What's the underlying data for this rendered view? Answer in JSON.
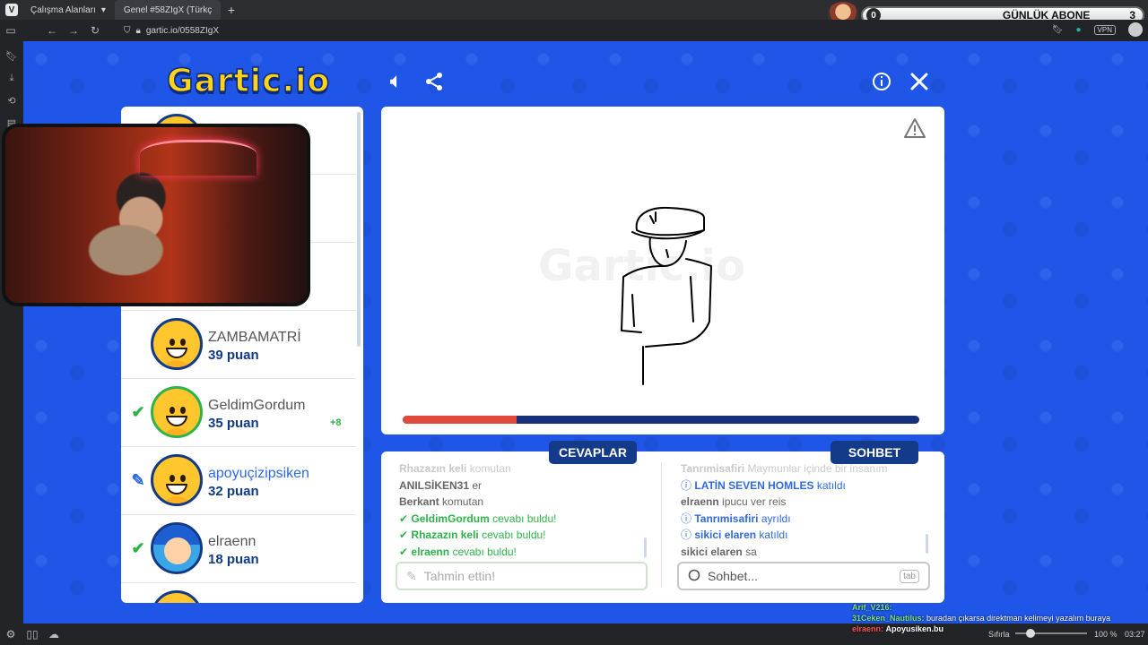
{
  "browser": {
    "workspace_label": "Çalışma Alanları",
    "tab_title": "Genel #58ZIgX (Türkçe) - G",
    "url": "gartic.io/0558ZIgX",
    "vpn_label": "VPN"
  },
  "sub_widget": {
    "count": "0",
    "label": "GÜNLÜK ABONE",
    "goal": "3"
  },
  "game": {
    "logo": "Gartic.io",
    "players": [
      {
        "name": "ZAMBAMATRİ",
        "score": "39 puan",
        "status": "",
        "bonus": ""
      },
      {
        "name": "GeldimGordum",
        "score": "35 puan",
        "status": "check",
        "bonus": "+8"
      },
      {
        "name": "apoyuçizipsiken",
        "score": "32 puan",
        "status": "pencil",
        "bonus": ""
      },
      {
        "name": "elraenn",
        "score": "18 puan",
        "status": "check",
        "bonus": ""
      }
    ],
    "progress_fraction": 0.22,
    "answers_tab": "CEVAPLAR",
    "chat_tab": "SOHBET",
    "answers": [
      {
        "user": "Rhazazın keli",
        "text": "komutan"
      },
      {
        "user": "ANILSİKEN31",
        "text": "er"
      },
      {
        "user": "Berkant",
        "text": "komutan"
      },
      {
        "user": "GeldimGordum",
        "text": "cevabı buldu!"
      },
      {
        "user": "Rhazazın keli",
        "text": "cevabı buldu!"
      },
      {
        "user": "elraenn",
        "text": "cevabı buldu!"
      }
    ],
    "chat": [
      {
        "user": "Tanrımisafiri",
        "text": "Maymunlar içinde bir insanım"
      },
      {
        "user": "LATİN SEVEN HOMLES",
        "text": "katıldı"
      },
      {
        "user": "elraenn",
        "text": "ipucu ver reis"
      },
      {
        "user": "Tanrımisafiri",
        "text": "ayrıldı"
      },
      {
        "user": "sikici elaren",
        "text": "katıldı"
      },
      {
        "user": "sikici elaren",
        "text": "sa"
      }
    ],
    "guess_placeholder": "Tahmin ettin!",
    "chat_placeholder": "Sohbet...",
    "tab_key": "tab"
  },
  "stream_chat": [
    {
      "user": "Arif_V216:",
      "text": ""
    },
    {
      "user": "31Ceken_Nautilus:",
      "text": "buradan çıkarsa direktman kelimeyi yazalım buraya"
    },
    {
      "user": "elraenn:",
      "text": "Apoyusiken.bu"
    }
  ],
  "statusbar": {
    "reset": "Sıfırla",
    "zoom": "100 %",
    "time": "03:27"
  },
  "colors": {
    "game_bg": "#1f56e8",
    "navy": "#133b8a",
    "green": "#2db34a",
    "accent_blue": "#2f6ae0",
    "progress": "#e04a3c"
  },
  "icons": [
    "volume-icon",
    "share-icon",
    "info-icon",
    "close-icon",
    "warning-icon",
    "check-icon",
    "pencil-icon",
    "search-icon"
  ]
}
